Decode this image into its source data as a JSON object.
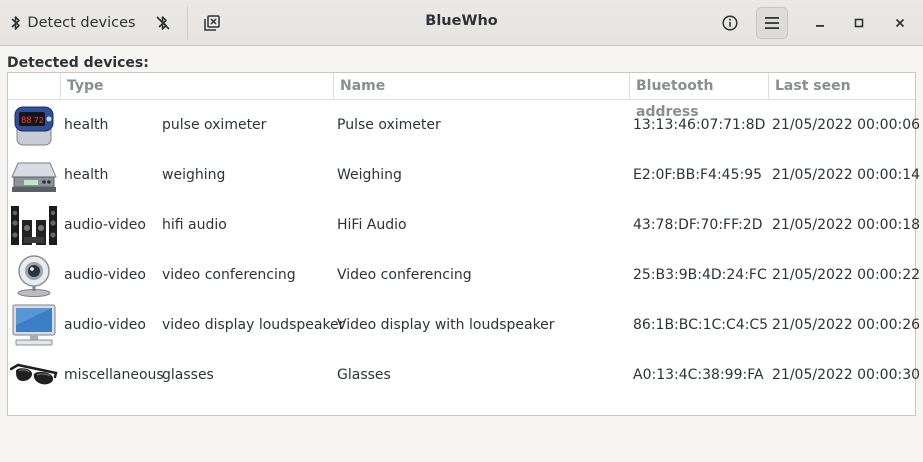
{
  "app": {
    "title": "BlueWho"
  },
  "toolbar": {
    "detect_label": "Detect devices",
    "icons": [
      "bluetooth-icon",
      "bluetooth-disabled-icon",
      "clear-list-icon",
      "info-icon",
      "hamburger-menu-icon",
      "minimize-icon",
      "maximize-icon",
      "close-icon"
    ]
  },
  "section": {
    "label": "Detected devices:"
  },
  "table": {
    "columns": [
      "Type",
      "Name",
      "Bluetooth address",
      "Last seen"
    ],
    "rows": [
      {
        "icon": "pulse-oximeter-icon",
        "type": "health",
        "subtype": "pulse oximeter",
        "name": "Pulse oximeter",
        "address": "13:13:46:07:71:8D",
        "last_seen": "21/05/2022 00:00:06"
      },
      {
        "icon": "weighing-scale-icon",
        "type": "health",
        "subtype": "weighing",
        "name": "Weighing",
        "address": "E2:0F:BB:F4:45:95",
        "last_seen": "21/05/2022 00:00:14"
      },
      {
        "icon": "hifi-speakers-icon",
        "type": "audio-video",
        "subtype": "hifi audio",
        "name": "HiFi Audio",
        "address": "43:78:DF:70:FF:2D",
        "last_seen": "21/05/2022 00:00:18"
      },
      {
        "icon": "webcam-icon",
        "type": "audio-video",
        "subtype": "video conferencing",
        "name": "Video conferencing",
        "address": "25:B3:9B:4D:24:FC",
        "last_seen": "21/05/2022 00:00:22"
      },
      {
        "icon": "monitor-icon",
        "type": "audio-video",
        "subtype": "video display loudspeaker",
        "name": "Video display with loudspeaker",
        "address": "86:1B:BC:1C:C4:C5",
        "last_seen": "21/05/2022 00:00:26"
      },
      {
        "icon": "glasses-icon",
        "type": "miscellaneous",
        "subtype": "glasses",
        "name": "Glasses",
        "address": "A0:13:4C:38:99:FA",
        "last_seen": "21/05/2022 00:00:30"
      }
    ]
  }
}
